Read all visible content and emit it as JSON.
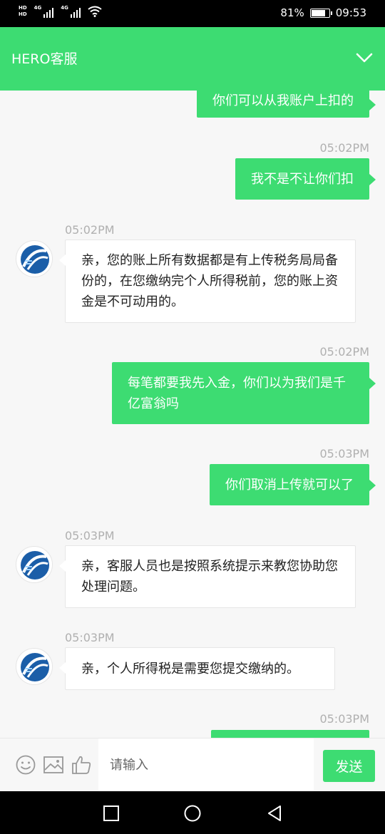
{
  "status_bar": {
    "hd1": "HD",
    "hd2": "HD",
    "sig1": "4G",
    "sig2": "4G",
    "battery_percent": "81%",
    "battery_level": 0.81,
    "time": "09:53"
  },
  "header": {
    "title": "HERO客服"
  },
  "messages": [
    {
      "dir": "out",
      "text": "你们可以从我账户上扣的"
    },
    {
      "dir": "out",
      "time": "05:02PM",
      "text": "我不是不让你们扣"
    },
    {
      "dir": "in",
      "time": "05:02PM",
      "text": "亲，您的账上所有数据都是有上传税务局局备份的，在您缴纳完个人所得税前，您的账上资金是不可动用的。"
    },
    {
      "dir": "out",
      "time": "05:02PM",
      "text": "每笔都要我先入金，你们以为我们是千亿富翁吗"
    },
    {
      "dir": "out",
      "time": "05:03PM",
      "text": "你们取消上传就可以了"
    },
    {
      "dir": "in",
      "time": "05:03PM",
      "text": "亲，客服人员也是按照系统提示来教您协助您处理问题。"
    },
    {
      "dir": "in",
      "time": "05:03PM",
      "text": "亲，个人所得税是需要您提交缴纳的。"
    },
    {
      "dir": "out",
      "time": "05:03PM",
      "text": ""
    }
  ],
  "input": {
    "placeholder": "请输入",
    "send_label": "发送"
  }
}
